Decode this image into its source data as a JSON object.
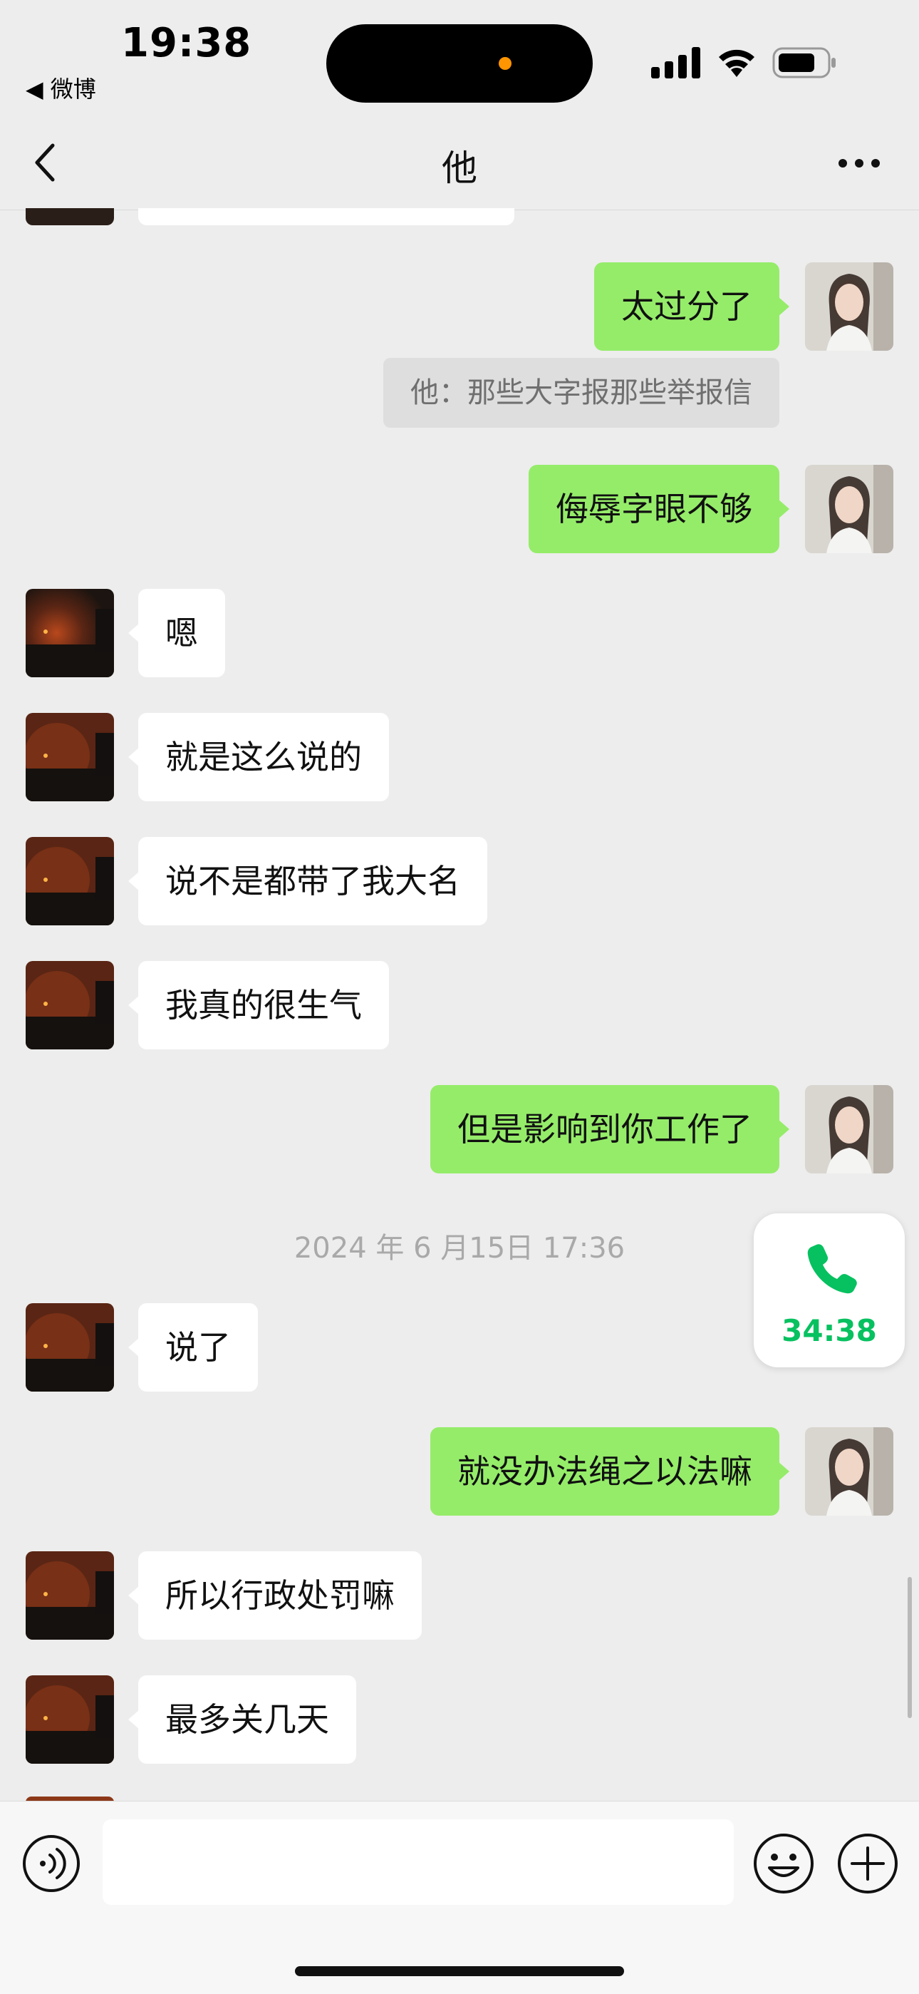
{
  "status_bar": {
    "time": "19:38",
    "back_app": "◀ 微博"
  },
  "nav": {
    "title": "他"
  },
  "messages": [
    {
      "side": "right",
      "text": "太过分了"
    },
    {
      "side": "quote",
      "text": "他：那些大字报那些举报信"
    },
    {
      "side": "right",
      "text": "侮辱字眼不够"
    },
    {
      "side": "left",
      "text": "嗯"
    },
    {
      "side": "left",
      "text": "就是这么说的"
    },
    {
      "side": "left",
      "text": "说不是都带了我大名"
    },
    {
      "side": "left",
      "text": "我真的很生气"
    },
    {
      "side": "right",
      "text": "但是影响到你工作了"
    },
    {
      "side": "timestamp",
      "text": "2024 年 6 月15日 17:36"
    },
    {
      "side": "left",
      "text": "说了"
    },
    {
      "side": "right",
      "text": "就没办法绳之以法嘛"
    },
    {
      "side": "left",
      "text": "所以行政处罚嘛"
    },
    {
      "side": "left",
      "text": "最多关几天"
    }
  ],
  "call_float": {
    "duration": "34:38",
    "icon": "phone-icon"
  },
  "input": {
    "value": "",
    "placeholder": ""
  },
  "colors": {
    "sent_bubble": "#95ec69",
    "received_bubble": "#ffffff",
    "background": "#ededed",
    "call_green": "#07c160"
  }
}
